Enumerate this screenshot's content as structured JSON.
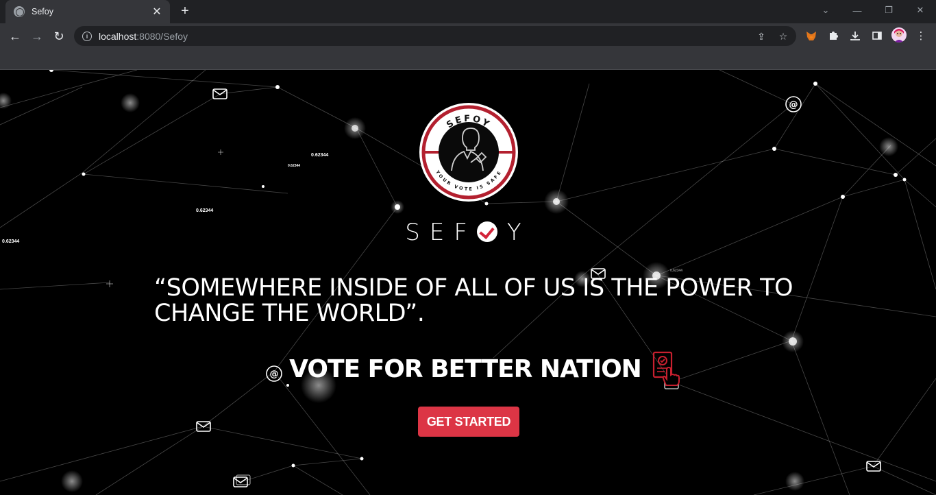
{
  "browser": {
    "tab_title": "Sefoy",
    "url_host": "localhost",
    "url_rest": ":8080/Sefoy"
  },
  "page": {
    "logo": {
      "ring_text_top": "SEFOY",
      "ring_text_bottom": "YOUR VOTE IS SAFE"
    },
    "brand": {
      "text_before": "SEF",
      "text_after": "Y"
    },
    "quote": "“SOMEWHERE INSIDE OF ALL OF US IS THE POWER TO CHANGE THE WORLD”.",
    "tagline": "VOTE FOR BETTER NATION",
    "cta_label": "GET STARTED",
    "floating_numbers": [
      "0.62344",
      "0.62344",
      "0.62344",
      "0.62344",
      "0.62344"
    ]
  },
  "colors": {
    "accent": "#dc3545",
    "logo_red": "#b3202f",
    "background": "#000000"
  },
  "icons": [
    "globe-icon",
    "close-icon",
    "plus-icon",
    "back-arrow-icon",
    "forward-arrow-icon",
    "reload-icon",
    "info-icon",
    "share-icon",
    "star-icon",
    "metamask-icon",
    "puzzle-icon",
    "download-icon",
    "sidepanel-icon",
    "avatar",
    "kebab-menu-icon",
    "envelope-icon",
    "at-sign-icon",
    "ballot-hand-icon"
  ]
}
